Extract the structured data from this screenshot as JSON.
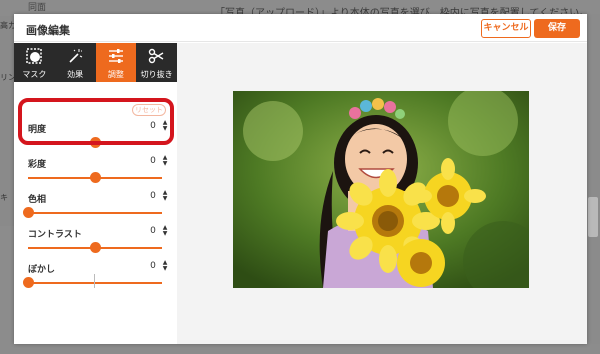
{
  "background": {
    "top_label": "同面",
    "instruction": "「写真（アップロード）」より本体の写真を選び、枠内に写真を配置してください。",
    "left_texts": [
      "高カ",
      "リン",
      "キ"
    ]
  },
  "modal": {
    "title": "画像編集",
    "cancel_label": "キャンセル",
    "save_label": "保存"
  },
  "toolbar": {
    "items": [
      {
        "label": "マスク",
        "icon": "mask-icon",
        "active": false
      },
      {
        "label": "効果",
        "icon": "magic-wand-icon",
        "active": false
      },
      {
        "label": "調整",
        "icon": "sliders-icon",
        "active": true
      },
      {
        "label": "切り抜き",
        "icon": "scissors-icon",
        "active": false
      }
    ]
  },
  "adjustments": {
    "reset_label": "リセット",
    "items": [
      {
        "label": "明度",
        "value": "0"
      },
      {
        "label": "彩度",
        "value": "0"
      },
      {
        "label": "色相",
        "value": "0"
      },
      {
        "label": "コントラスト",
        "value": "0"
      },
      {
        "label": "ぼかし",
        "value": "0"
      }
    ]
  },
  "colors": {
    "accent": "#ee6a1e",
    "highlight": "#d4151d"
  }
}
